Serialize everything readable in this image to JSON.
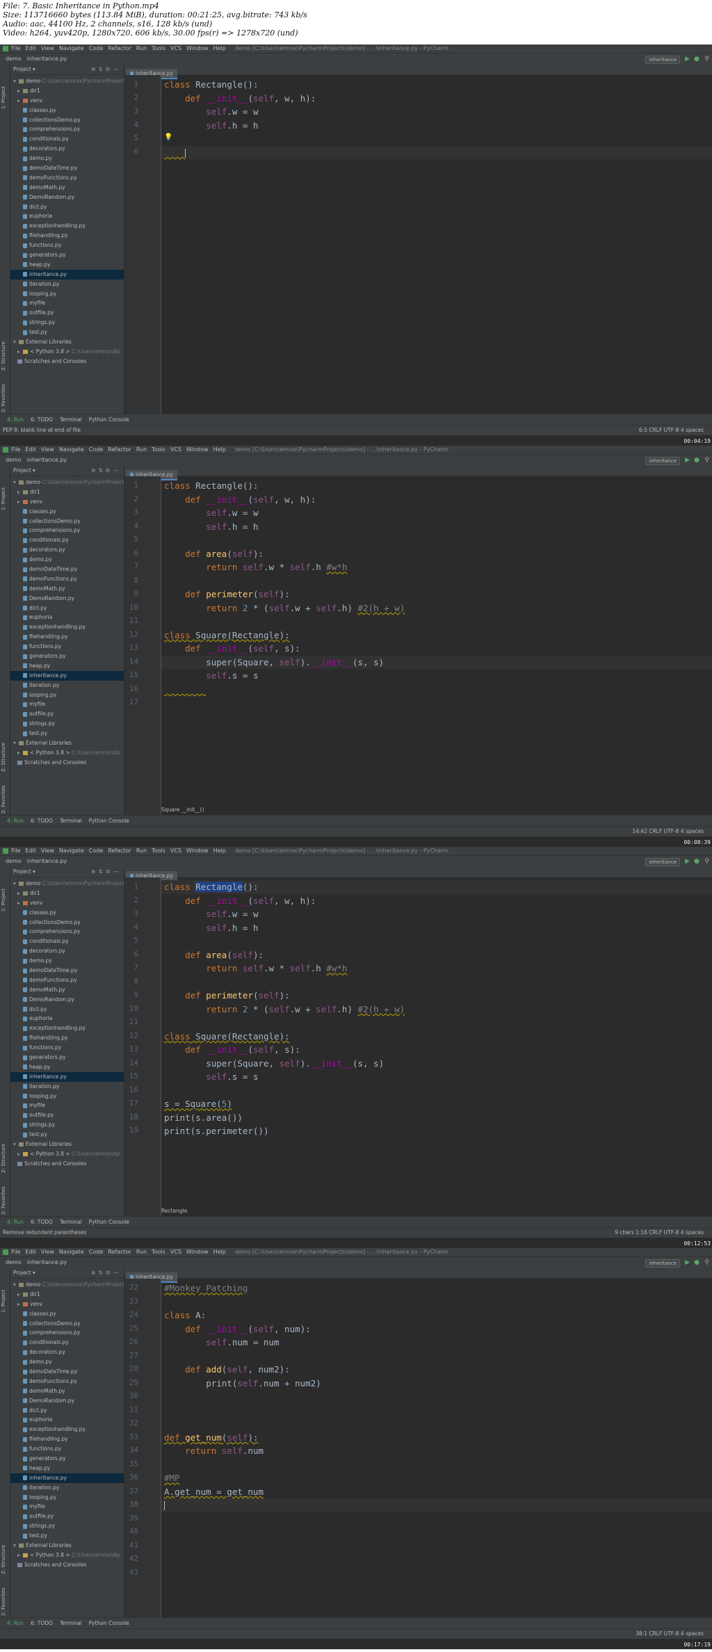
{
  "meta": {
    "line1": "File: 7. Basic Inheritance in Python.mp4",
    "line2": "Size: 113716660 bytes (113.84 MiB), duration: 00:21:25, avg.bitrate: 743 kb/s",
    "line3": "Audio: aac, 44100 Hz, 2 channels, s16, 128 kb/s (und)",
    "line4": "Video: h264, yuv420p, 1280x720, 606 kb/s, 30.00 fps(r) => 1278x720 (und)"
  },
  "ide": {
    "menu": [
      "File",
      "Edit",
      "View",
      "Navigate",
      "Code",
      "Refactor",
      "Run",
      "Tools",
      "VCS",
      "Window",
      "Help"
    ],
    "window_title": "demo [C:\\Users\\emrox\\PycharmProjects\\demo] - ...\\inheritance.py - PyCharm",
    "crumb_project": "demo",
    "crumb_file": "inheritance.py",
    "run_config": "inheritance",
    "tab_label": "inheritance.py",
    "project_header": "Project",
    "tool_run": "4: Run",
    "tool_todo": "6: TODO",
    "tool_terminal": "Terminal",
    "tool_console": "Python Console",
    "vtab_project": "1: Project",
    "vtab_structure": "Z: Structure",
    "vtab_favorites": "2: Favorites"
  },
  "tree": [
    {
      "label": "demo",
      "type": "root",
      "path": "C:\\Users\\emrox\\PycharmProjects"
    },
    {
      "label": "dir1",
      "type": "folder"
    },
    {
      "label": "venv",
      "type": "venv"
    },
    {
      "label": "classes.py",
      "type": "file"
    },
    {
      "label": "collectionsDemo.py",
      "type": "file"
    },
    {
      "label": "comprehensions.py",
      "type": "file"
    },
    {
      "label": "conditionals.py",
      "type": "file"
    },
    {
      "label": "decorators.py",
      "type": "file"
    },
    {
      "label": "demo.py",
      "type": "file"
    },
    {
      "label": "demoDateTime.py",
      "type": "file"
    },
    {
      "label": "demoFunctions.py",
      "type": "file"
    },
    {
      "label": "demoMath.py",
      "type": "file"
    },
    {
      "label": "DemoRandom.py",
      "type": "file"
    },
    {
      "label": "dict.py",
      "type": "file"
    },
    {
      "label": "euphoria",
      "type": "file"
    },
    {
      "label": "exceptionhandling.py",
      "type": "file"
    },
    {
      "label": "filehandling.py",
      "type": "file"
    },
    {
      "label": "functions.py",
      "type": "file"
    },
    {
      "label": "generators.py",
      "type": "file"
    },
    {
      "label": "heap.py",
      "type": "file"
    },
    {
      "label": "inheritance.py",
      "type": "file",
      "selected": true
    },
    {
      "label": "iteration.py",
      "type": "file"
    },
    {
      "label": "looping.py",
      "type": "file"
    },
    {
      "label": "myfile",
      "type": "file"
    },
    {
      "label": "outfile.py",
      "type": "file"
    },
    {
      "label": "strings.py",
      "type": "file"
    },
    {
      "label": "test.py",
      "type": "file"
    },
    {
      "label": "External Libraries",
      "type": "ext"
    },
    {
      "label": "< Python 3.8 >",
      "type": "py",
      "path": "C:\\Users\\emrox\\Ap"
    },
    {
      "label": "Scratches and Consoles",
      "type": "scratch"
    }
  ],
  "frames": [
    {
      "timestamp": "00:04:19",
      "status_msg": "PEP 8: blank line at end of file",
      "status_pos": "6:5   CRLF   UTF-8   4 spaces",
      "breadcrumb": "",
      "lines": [
        {
          "n": "1",
          "html": "<span class='kw'>class</span> Rectangle():"
        },
        {
          "n": "2",
          "html": "    <span class='kw'>def</span> <span class='magic'>__init__</span>(<span class='self'>self</span>, w, h):"
        },
        {
          "n": "3",
          "html": "        <span class='self'>self</span>.w = w"
        },
        {
          "n": "4",
          "html": "        <span class='self'>self</span>.h = h"
        },
        {
          "n": "5",
          "html": ""
        },
        {
          "n": "6",
          "html": "<span class='warn'>    </span><span class='caret'></span>",
          "current": true
        }
      ]
    },
    {
      "timestamp": "00:08:39",
      "status_msg": "",
      "status_pos": "14:42   CRLF   UTF-8   4 spaces",
      "breadcrumb": "Square    __init__()",
      "lines": [
        {
          "n": "1",
          "html": "<span class='kw'>class</span> Rectangle():"
        },
        {
          "n": "2",
          "html": "    <span class='kw'>def</span> <span class='magic'>__init__</span>(<span class='self'>self</span>, w, h):"
        },
        {
          "n": "3",
          "html": "        <span class='self'>self</span>.w = w"
        },
        {
          "n": "4",
          "html": "        <span class='self'>self</span>.h = h"
        },
        {
          "n": "5",
          "html": ""
        },
        {
          "n": "6",
          "html": "    <span class='kw'>def</span> <span class='fn'>area</span>(<span class='self'>self</span>):"
        },
        {
          "n": "7",
          "html": "        <span class='kw'>return</span> <span class='self'>self</span>.w * <span class='self'>self</span>.h <span class='cm warn'>#w*h</span>"
        },
        {
          "n": "8",
          "html": ""
        },
        {
          "n": "9",
          "html": "    <span class='kw'>def</span> <span class='fn'>perimeter</span>(<span class='self'>self</span>):"
        },
        {
          "n": "10",
          "html": "        <span class='kw'>return</span> <span class='num'>2</span> * (<span class='self'>self</span>.w + <span class='self'>self</span>.h) <span class='cm warn'>#2(h + w)</span>"
        },
        {
          "n": "11",
          "html": ""
        },
        {
          "n": "12",
          "html": "<span class='warn'><span class='kw'>class</span> Square(Rectangle):</span>"
        },
        {
          "n": "13",
          "html": "    <span class='kw'>def</span> <span class='magic'>__init__</span>(<span class='self'>self</span>, s):"
        },
        {
          "n": "14",
          "html": "        super(Square, <span class='self'>self</span>).<span class='magic'>__init__</span>(s, s)",
          "current": true
        },
        {
          "n": "15",
          "html": "        <span class='self'>self</span>.s = s"
        },
        {
          "n": "16",
          "html": "<span class='warn'>        </span>"
        },
        {
          "n": "17",
          "html": ""
        }
      ]
    },
    {
      "timestamp": "00:12:53",
      "status_msg": "Remove redundant parentheses",
      "status_pos": "9 chars   1:16   CRLF   UTF-8   4 spaces",
      "breadcrumb": "Rectangle",
      "lines": [
        {
          "n": "1",
          "html": "<span class='kw'>class</span> <span class='hl'>Rectangle</span>():",
          "current": true
        },
        {
          "n": "2",
          "html": "    <span class='kw'>def</span> <span class='magic'>__init__</span>(<span class='self'>self</span>, w, h):"
        },
        {
          "n": "3",
          "html": "        <span class='self'>self</span>.w = w"
        },
        {
          "n": "4",
          "html": "        <span class='self'>self</span>.h = h"
        },
        {
          "n": "5",
          "html": ""
        },
        {
          "n": "6",
          "html": "    <span class='kw'>def</span> <span class='fn'>area</span>(<span class='self'>self</span>):"
        },
        {
          "n": "7",
          "html": "        <span class='kw'>return</span> <span class='self'>self</span>.w * <span class='self'>self</span>.h <span class='cm warn'>#w*h</span>"
        },
        {
          "n": "8",
          "html": ""
        },
        {
          "n": "9",
          "html": "    <span class='kw'>def</span> <span class='fn'>perimeter</span>(<span class='self'>self</span>):"
        },
        {
          "n": "10",
          "html": "        <span class='kw'>return</span> <span class='num'>2</span> * (<span class='self'>self</span>.w + <span class='self'>self</span>.h) <span class='cm warn'>#2(h + w)</span>"
        },
        {
          "n": "11",
          "html": ""
        },
        {
          "n": "12",
          "html": "<span class='warn'><span class='kw'>class</span> Square(Rectangle):</span>"
        },
        {
          "n": "13",
          "html": "    <span class='kw'>def</span> <span class='magic'>__init__</span>(<span class='self'>self</span>, s):"
        },
        {
          "n": "14",
          "html": "        super(Square, <span class='self'>self</span>).<span class='magic'>__init__</span>(s, s)"
        },
        {
          "n": "15",
          "html": "        <span class='self'>self</span>.s = s"
        },
        {
          "n": "16",
          "html": ""
        },
        {
          "n": "17",
          "html": "<span class='warn'>s = Square(<span class='num'>5</span>)</span>"
        },
        {
          "n": "18",
          "html": "print(s.area())"
        },
        {
          "n": "19",
          "html": "print(s.perimeter())"
        }
      ]
    },
    {
      "timestamp": "00:17:19",
      "status_msg": "",
      "status_pos": "38:1   CRLF   UTF-8   4 spaces",
      "breadcrumb": "",
      "lines": [
        {
          "n": "22",
          "html": "<span class='cm warn'>#Monkey Patching</span>"
        },
        {
          "n": "23",
          "html": ""
        },
        {
          "n": "24",
          "html": "<span class='kw'>class</span> A:"
        },
        {
          "n": "25",
          "html": "    <span class='kw'>def</span> <span class='magic'>__init__</span>(<span class='self'>self</span>, num):"
        },
        {
          "n": "26",
          "html": "        <span class='self'>self</span>.num = num"
        },
        {
          "n": "27",
          "html": ""
        },
        {
          "n": "28",
          "html": "    <span class='kw'>def</span> <span class='fn'>add</span>(<span class='self'>self</span>, num2):"
        },
        {
          "n": "29",
          "html": "        print(<span class='self'>self</span>.num + num2)"
        },
        {
          "n": "30",
          "html": ""
        },
        {
          "n": "31",
          "html": ""
        },
        {
          "n": "32",
          "html": ""
        },
        {
          "n": "33",
          "html": "<span class='warn'><span class='kw'>def</span> <span class='fn'>get_num</span>(<span class='self'>self</span>):</span>"
        },
        {
          "n": "34",
          "html": "    <span class='kw'>return</span> <span class='self'>self</span>.num"
        },
        {
          "n": "35",
          "html": ""
        },
        {
          "n": "36",
          "html": "<span class='cm warn'>#MP</span>"
        },
        {
          "n": "37",
          "html": "<span class='warn'>A.get_num = get_num</span>"
        },
        {
          "n": "38",
          "html": "<span class='caret'></span>",
          "current": true
        },
        {
          "n": "39",
          "html": ""
        },
        {
          "n": "40",
          "html": ""
        },
        {
          "n": "41",
          "html": ""
        },
        {
          "n": "42",
          "html": ""
        },
        {
          "n": "43",
          "html": ""
        }
      ]
    }
  ]
}
